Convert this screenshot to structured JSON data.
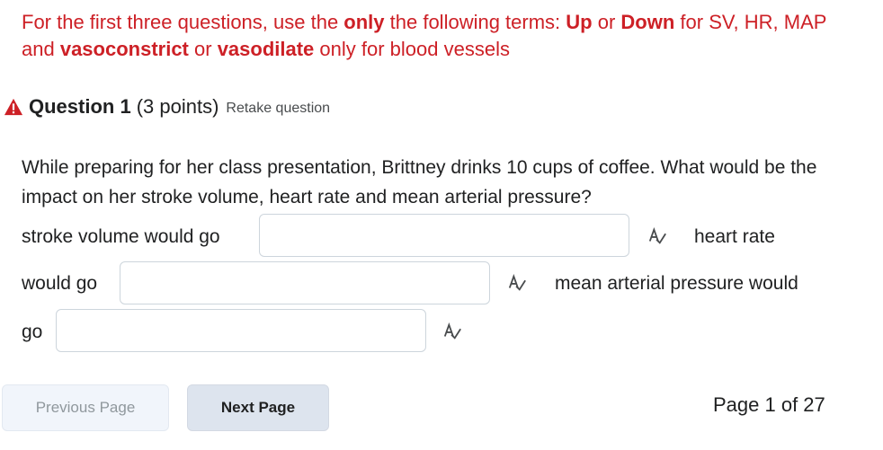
{
  "instructions": {
    "part1": "For the first three questions, use the ",
    "bold1": "only",
    "part2": " the following terms: ",
    "bold2": "Up",
    "part3": " or ",
    "bold3": "Down",
    "part4": " for SV, HR, MAP and ",
    "bold4": "vasoconstrict",
    "part5": " or ",
    "bold5": "vasodilate",
    "part6": " only for blood vessels"
  },
  "question": {
    "title": "Question 1",
    "points": "(3 points)",
    "retake": "Retake question",
    "text": "While preparing for her class presentation, Brittney drinks 10 cups of coffee. What would be the impact on her stroke volume, heart rate and mean arterial pressure?",
    "label_sv": "stroke volume would go",
    "label_hr_a": "heart rate",
    "label_hr_b": "would go",
    "label_map_a": "mean arterial pressure would",
    "label_map_b": "go",
    "answer_sv": "",
    "answer_hr": "",
    "answer_map": ""
  },
  "nav": {
    "previous": "Previous Page",
    "next": "Next Page",
    "page_indicator": "Page 1 of 27"
  },
  "icons": {
    "warning": "warning-triangle-icon",
    "spellcheck": "spellcheck-icon"
  },
  "colors": {
    "instruction_red": "#cd2026",
    "warning_red": "#cd2026",
    "border": "#cdd5dc"
  }
}
